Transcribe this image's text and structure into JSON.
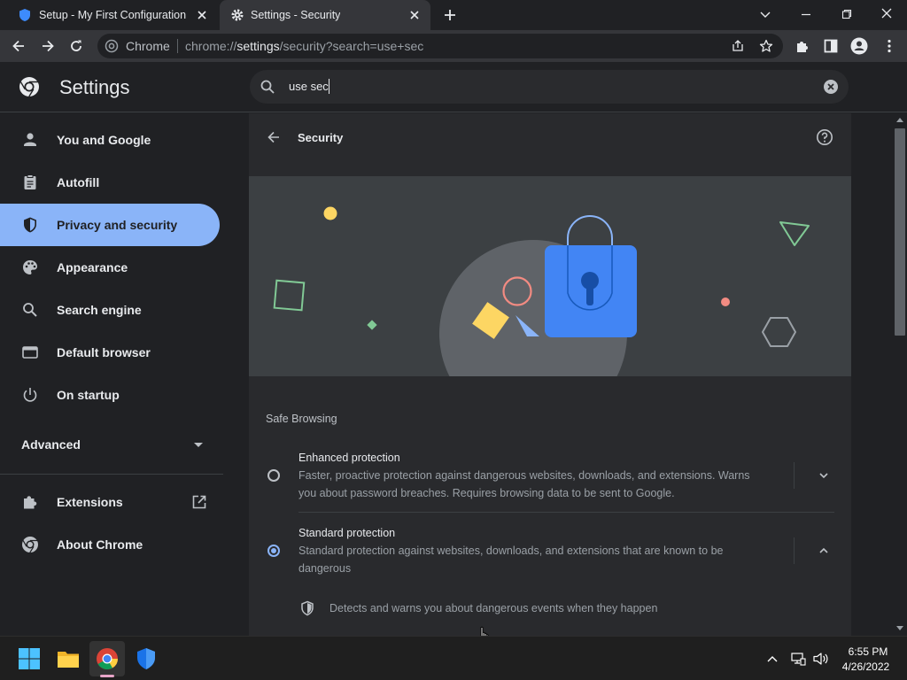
{
  "tabs": [
    {
      "title": "Setup - My First Configuration - N"
    },
    {
      "title": "Settings - Security"
    }
  ],
  "omnibox": {
    "site_label": "Chrome",
    "url_prefix": "chrome://",
    "url_host": "settings",
    "url_path": "/security?search=use+sec"
  },
  "settings": {
    "title": "Settings",
    "search_value": "use sec",
    "nav": [
      {
        "label": "You and Google"
      },
      {
        "label": "Autofill"
      },
      {
        "label": "Privacy and security"
      },
      {
        "label": "Appearance"
      },
      {
        "label": "Search engine"
      },
      {
        "label": "Default browser"
      },
      {
        "label": "On startup"
      }
    ],
    "advanced": "Advanced",
    "extensions": "Extensions",
    "about": "About Chrome"
  },
  "page": {
    "title": "Security",
    "section": "Safe Browsing",
    "options": [
      {
        "title": "Enhanced protection",
        "desc_line1": "Faster, proactive protection against dangerous websites, downloads, and extensions. Warns",
        "desc_line2": "you about password breaches. Requires browsing data to be sent to Google.",
        "selected": false
      },
      {
        "title": "Standard protection",
        "desc_line1": "Standard protection against websites, downloads, and extensions that are known to be",
        "desc_line2": "dangerous",
        "selected": true
      }
    ],
    "sub_item": "Detects and warns you about dangerous events when they happen"
  },
  "taskbar": {
    "time": "6:55 PM",
    "date": "4/26/2022"
  },
  "colors": {
    "accent": "#8ab4f8",
    "bg": "#202124",
    "card": "#292a2d",
    "lock_blue": "#4285f4"
  }
}
